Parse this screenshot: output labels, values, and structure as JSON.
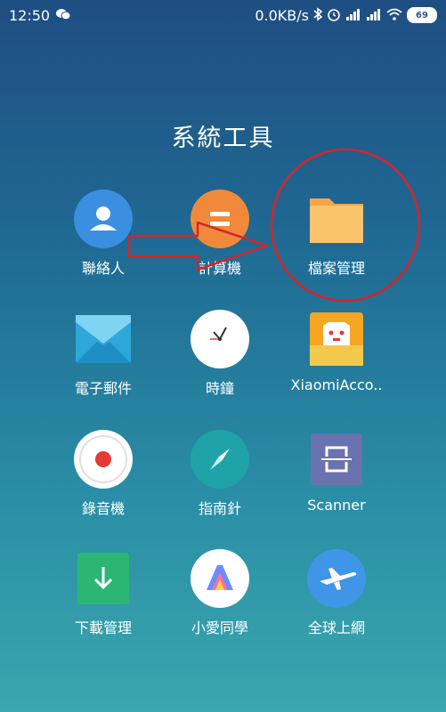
{
  "status_bar": {
    "time": "12:50",
    "net_speed": "0.0KB/s",
    "battery": "69",
    "icons": [
      "wechat-icon",
      "bluetooth-icon",
      "alarm-icon",
      "signal-icon",
      "wifi-icon",
      "battery-icon"
    ]
  },
  "folder": {
    "title": "系統工具",
    "apps": [
      {
        "name": "contacts",
        "label": "聯絡人",
        "icon": "contacts-icon",
        "color": "#3b8fe0"
      },
      {
        "name": "calculator",
        "label": "計算機",
        "icon": "calculator-icon",
        "color": "#f08a3a"
      },
      {
        "name": "file-manager",
        "label": "檔案管理",
        "icon": "folder-icon",
        "color": "#f6b35a"
      },
      {
        "name": "email",
        "label": "電子郵件",
        "icon": "email-icon",
        "color": "#2ea7d9"
      },
      {
        "name": "clock",
        "label": "時鐘",
        "icon": "clock-icon",
        "color": "#ffffff"
      },
      {
        "name": "xiaomi-account",
        "label": "XiaomiAcco..",
        "icon": "mi-account-icon",
        "color": "#f5a623"
      },
      {
        "name": "recorder",
        "label": "錄音機",
        "icon": "record-icon",
        "color": "#e53935"
      },
      {
        "name": "compass",
        "label": "指南針",
        "icon": "compass-icon",
        "color": "#1fa3a8"
      },
      {
        "name": "scanner",
        "label": "Scanner",
        "icon": "scanner-icon",
        "color": "#6a72b0"
      },
      {
        "name": "downloads",
        "label": "下載管理",
        "icon": "download-icon",
        "color": "#2bb673"
      },
      {
        "name": "xiaoai",
        "label": "小愛同學",
        "icon": "xiaoai-icon",
        "color": "#ffffff"
      },
      {
        "name": "global-internet",
        "label": "全球上網",
        "icon": "airplane-icon",
        "color": "#3f95e6"
      }
    ]
  },
  "annotations": {
    "arrow_color": "#d6242a",
    "highlight_circle_color": "#d6242a"
  }
}
